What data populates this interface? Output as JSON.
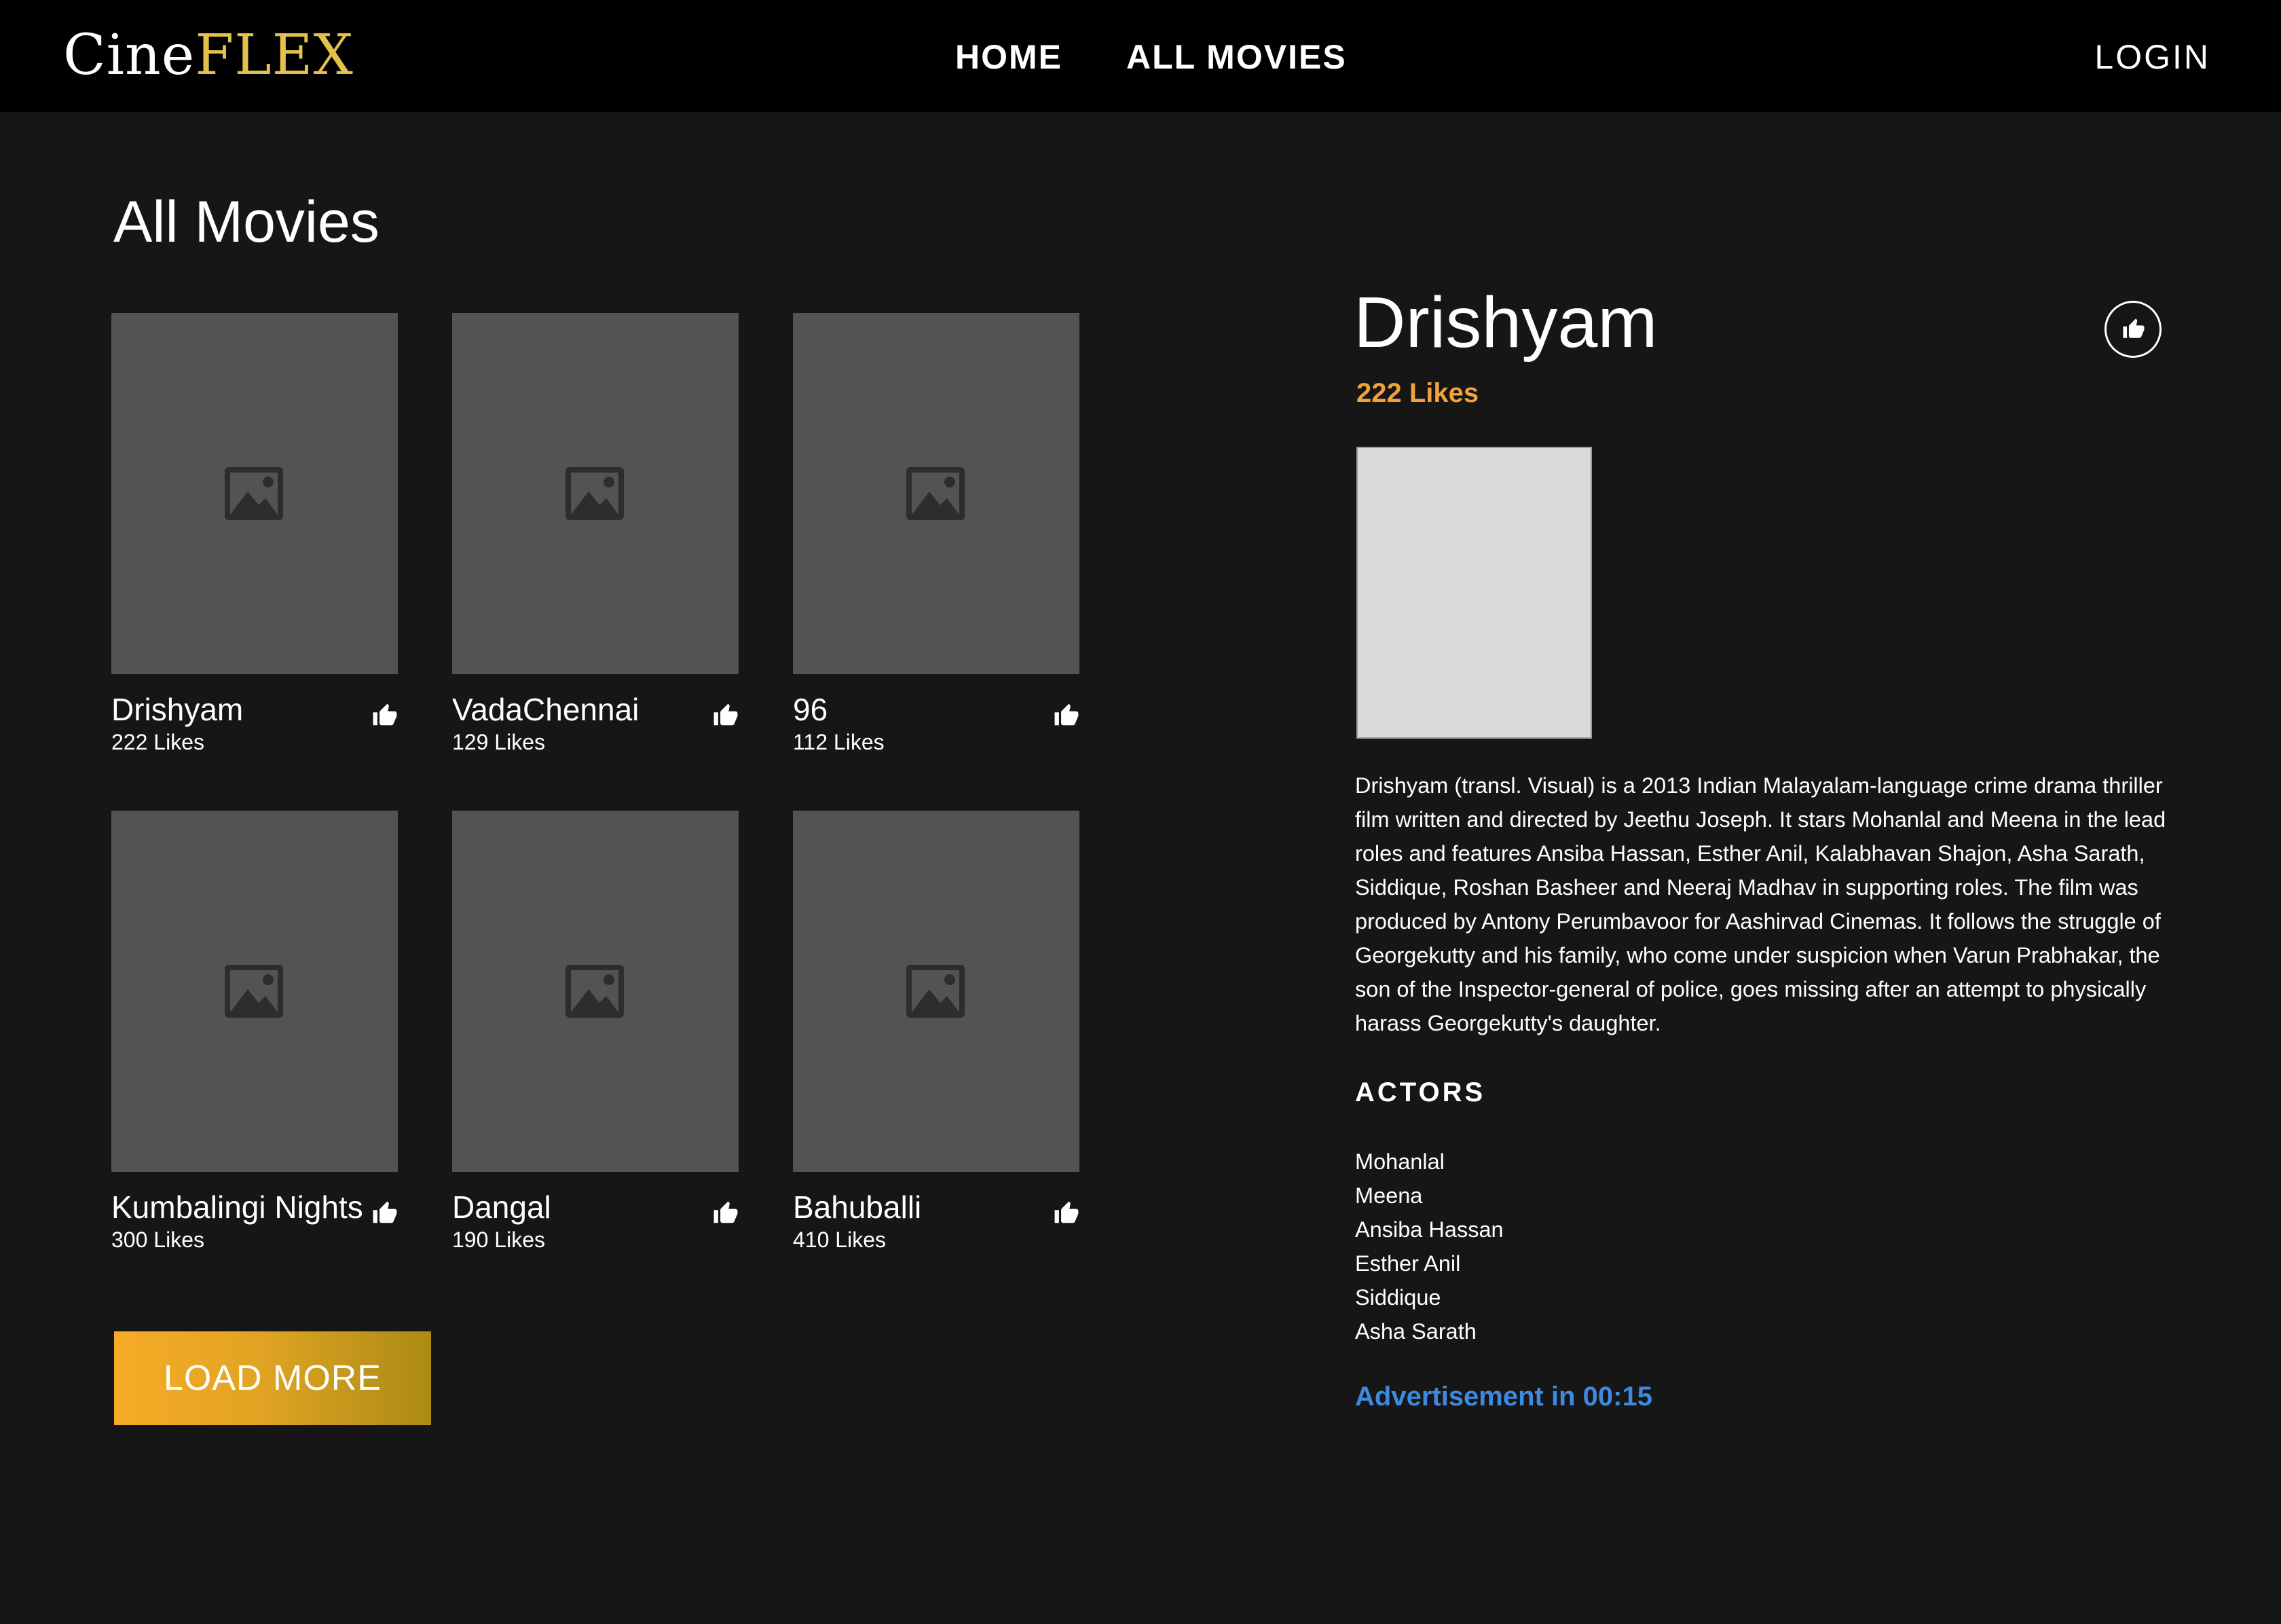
{
  "navbar": {
    "logo_part1": "Cine",
    "logo_part2": "FLEX",
    "home_label": "HOME",
    "all_movies_label": "ALL MOVIES",
    "login_label": "LOGIN"
  },
  "main": {
    "title": "All Movies",
    "load_more_label": "LOAD MORE"
  },
  "movies": [
    {
      "title": "Drishyam",
      "likes": "222 Likes"
    },
    {
      "title": "VadaChennai",
      "likes": "129 Likes"
    },
    {
      "title": "96",
      "likes": "112 Likes"
    },
    {
      "title": "Kumbalingi Nights",
      "likes": "300 Likes"
    },
    {
      "title": "Dangal",
      "likes": "190 Likes"
    },
    {
      "title": "Bahuballi",
      "likes": "410 Likes"
    }
  ],
  "detail": {
    "title": "Drishyam",
    "likes": "222 Likes",
    "description": "Drishyam (transl. Visual) is a 2013 Indian Malayalam-language crime drama thriller film written and directed by Jeethu Joseph. It stars Mohanlal and Meena in the lead roles and features Ansiba Hassan, Esther Anil, Kalabhavan Shajon, Asha Sarath, Siddique, Roshan Basheer and Neeraj Madhav in supporting roles. The film was produced by Antony Perumbavoor for Aashirvad Cinemas. It follows the struggle of Georgekutty and his family, who come under suspicion when Varun Prabhakar, the son of the Inspector-general of police, goes missing after an attempt to physically harass Georgekutty's daughter.",
    "actors_heading": "ACTORS",
    "actors": [
      "Mohanlal",
      "Meena",
      "Ansiba Hassan",
      "Esther Anil",
      "Siddique",
      "Asha Sarath"
    ],
    "advertisement": "Advertisement in 00:15"
  },
  "colors": {
    "background": "#161616",
    "navbar": "#000000",
    "logo_accent": "#e3c14a",
    "likes_accent": "#f3a23b",
    "advert": "#3d8ae0",
    "poster_placeholder": "#535353",
    "button_gradient_start": "#f6ab26",
    "button_gradient_end": "#ab8b15"
  },
  "icons": {
    "poster": "image-placeholder-icon",
    "like": "thumbs-up-icon"
  }
}
